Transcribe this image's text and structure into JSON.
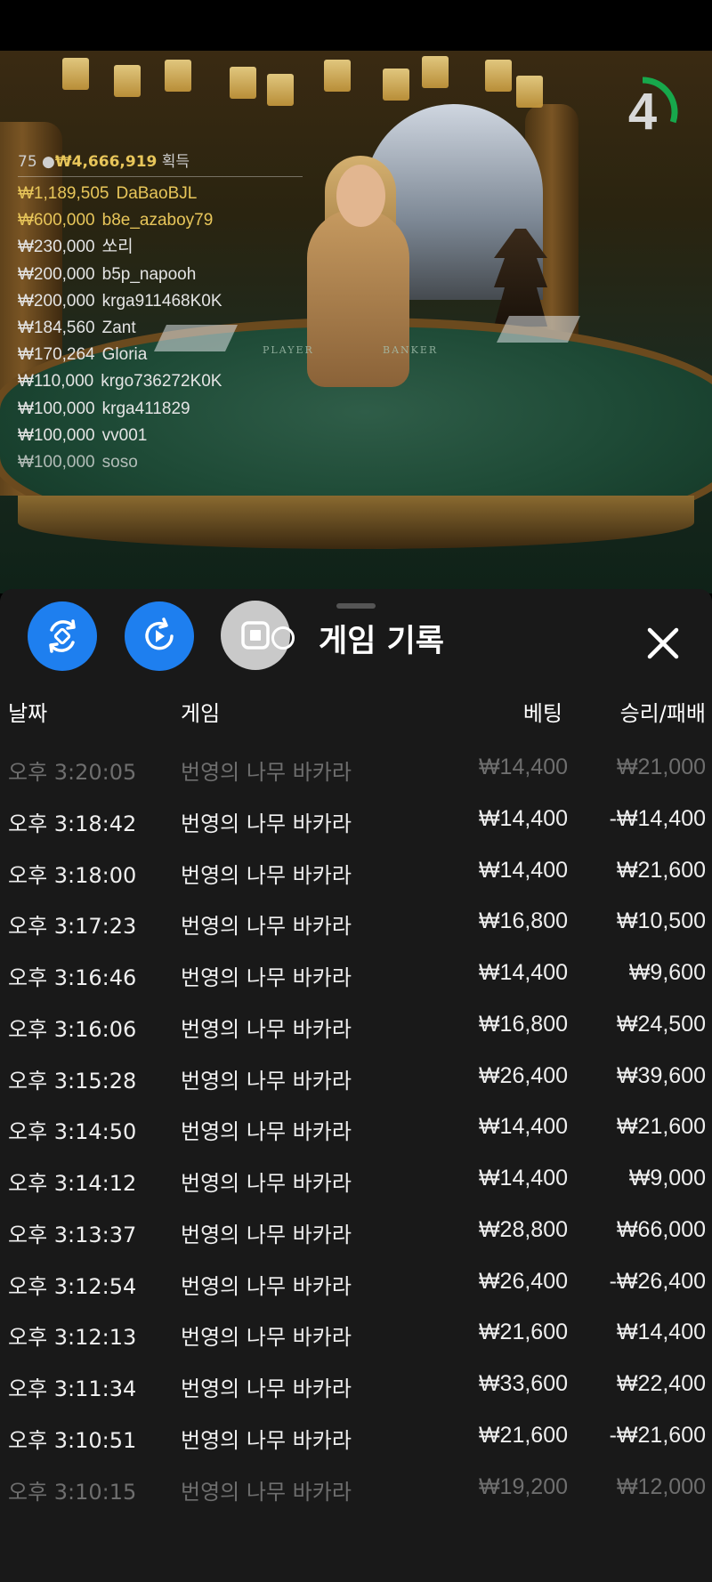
{
  "video": {
    "timer": "4",
    "timer_fraction": 0.3,
    "table_player_label": "PLAYER",
    "table_banker_label": "BANKER"
  },
  "winners": {
    "players_count": "75",
    "total_won": "₩4,666,919",
    "won_label": "획득",
    "list": [
      {
        "amount": "₩1,189,505",
        "name": "DaBaoBJL",
        "highlight": true
      },
      {
        "amount": "₩600,000",
        "name": "b8e_azaboy79",
        "highlight": true
      },
      {
        "amount": "₩230,000",
        "name": "쏘리",
        "highlight": false
      },
      {
        "amount": "₩200,000",
        "name": "b5p_napooh",
        "highlight": false
      },
      {
        "amount": "₩200,000",
        "name": "krga911468K0K",
        "highlight": false
      },
      {
        "amount": "₩184,560",
        "name": "Zant",
        "highlight": false
      },
      {
        "amount": "₩170,264",
        "name": "Gloria",
        "highlight": false
      },
      {
        "amount": "₩110,000",
        "name": "krgo736272K0K",
        "highlight": false
      },
      {
        "amount": "₩100,000",
        "name": "krga411829",
        "highlight": false
      },
      {
        "amount": "₩100,000",
        "name": "vv001",
        "highlight": false
      },
      {
        "amount": "₩100,000",
        "name": "soso",
        "highlight": false
      }
    ]
  },
  "sheet": {
    "title": "게임 기록",
    "columns": {
      "date": "날짜",
      "game": "게임",
      "bet": "베팅",
      "result": "승리/패배"
    },
    "rows": [
      {
        "time": "오후 3:20:05",
        "game": "번영의 나무 바카라",
        "bet": "₩14,400",
        "result": "₩21,000"
      },
      {
        "time": "오후 3:18:42",
        "game": "번영의 나무 바카라",
        "bet": "₩14,400",
        "result": "-₩14,400"
      },
      {
        "time": "오후 3:18:00",
        "game": "번영의 나무 바카라",
        "bet": "₩14,400",
        "result": "₩21,600"
      },
      {
        "time": "오후 3:17:23",
        "game": "번영의 나무 바카라",
        "bet": "₩16,800",
        "result": "₩10,500"
      },
      {
        "time": "오후 3:16:46",
        "game": "번영의 나무 바카라",
        "bet": "₩14,400",
        "result": "₩9,600"
      },
      {
        "time": "오후 3:16:06",
        "game": "번영의 나무 바카라",
        "bet": "₩16,800",
        "result": "₩24,500"
      },
      {
        "time": "오후 3:15:28",
        "game": "번영의 나무 바카라",
        "bet": "₩26,400",
        "result": "₩39,600"
      },
      {
        "time": "오후 3:14:50",
        "game": "번영의 나무 바카라",
        "bet": "₩14,400",
        "result": "₩21,600"
      },
      {
        "time": "오후 3:14:12",
        "game": "번영의 나무 바카라",
        "bet": "₩14,400",
        "result": "₩9,000"
      },
      {
        "time": "오후 3:13:37",
        "game": "번영의 나무 바카라",
        "bet": "₩28,800",
        "result": "₩66,000"
      },
      {
        "time": "오후 3:12:54",
        "game": "번영의 나무 바카라",
        "bet": "₩26,400",
        "result": "-₩26,400"
      },
      {
        "time": "오후 3:12:13",
        "game": "번영의 나무 바카라",
        "bet": "₩21,600",
        "result": "₩14,400"
      },
      {
        "time": "오후 3:11:34",
        "game": "번영의 나무 바카라",
        "bet": "₩33,600",
        "result": "₩22,400"
      },
      {
        "time": "오후 3:10:51",
        "game": "번영의 나무 바카라",
        "bet": "₩21,600",
        "result": "-₩21,600"
      },
      {
        "time": "오후 3:10:15",
        "game": "번영의 나무 바카라",
        "bet": "₩19,200",
        "result": "₩12,000"
      }
    ]
  }
}
